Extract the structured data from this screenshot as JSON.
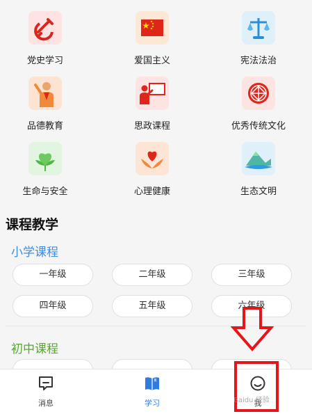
{
  "topics": [
    {
      "label": "党史学习",
      "icon": "hammer-sickle-icon"
    },
    {
      "label": "爱国主义",
      "icon": "national-flag-icon"
    },
    {
      "label": "宪法法治",
      "icon": "scales-icon"
    },
    {
      "label": "品德教育",
      "icon": "young-pioneer-icon"
    },
    {
      "label": "思政课程",
      "icon": "teacher-board-icon"
    },
    {
      "label": "优秀传统文化",
      "icon": "chinese-knot-icon"
    },
    {
      "label": "生命与安全",
      "icon": "heart-leaf-icon"
    },
    {
      "label": "心理健康",
      "icon": "heart-hands-icon"
    },
    {
      "label": "生态文明",
      "icon": "mountain-icon"
    }
  ],
  "course": {
    "title": "课程教学",
    "primary": {
      "title": "小学课程",
      "color": "#3a8ee6",
      "grades": [
        "一年级",
        "二年级",
        "三年级",
        "四年级",
        "五年级",
        "六年级"
      ]
    },
    "junior": {
      "title": "初中课程",
      "color": "#5aa630"
    }
  },
  "tabbar": {
    "items": [
      {
        "label": "消息",
        "icon": "message-icon"
      },
      {
        "label": "学习",
        "icon": "book-icon",
        "active": true
      },
      {
        "label": "我",
        "icon": "profile-icon"
      }
    ],
    "active_color": "#2f7ce0"
  },
  "annotation_color": "#e4161b",
  "watermark": "Baidu 经验"
}
